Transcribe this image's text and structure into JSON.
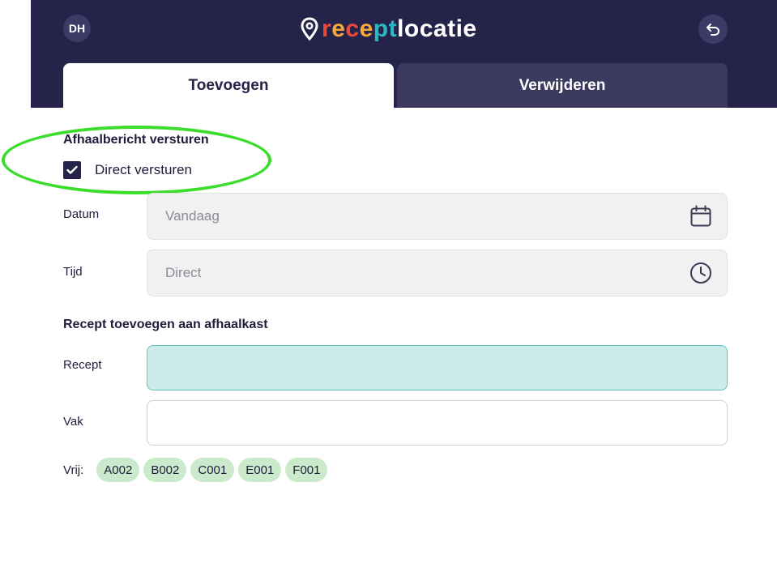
{
  "header": {
    "avatar_initials": "DH",
    "logo": {
      "part1": "r",
      "part2": "e",
      "part3": "c",
      "part4": "e",
      "part5": "pt",
      "part6": "locatie"
    },
    "back_icon": "undo-arrow-icon",
    "tabs": [
      {
        "label": "Toevoegen",
        "active": true
      },
      {
        "label": "Verwijderen",
        "active": false
      }
    ]
  },
  "afhaalbericht": {
    "title": "Afhaalbericht versturen",
    "checkbox_label": "Direct versturen",
    "checked": true
  },
  "datum": {
    "label": "Datum",
    "placeholder": "Vandaag",
    "icon": "calendar-icon"
  },
  "tijd": {
    "label": "Tijd",
    "placeholder": "Direct",
    "icon": "clock-icon"
  },
  "recept_section": {
    "title": "Recept toevoegen aan afhaalkast",
    "recept_label": "Recept",
    "recept_value": "",
    "vak_label": "Vak",
    "vak_value": ""
  },
  "vrij": {
    "label": "Vrij:",
    "chips": [
      "A002",
      "B002",
      "C001",
      "E001",
      "F001"
    ]
  },
  "colors": {
    "header_bg": "#25234a",
    "highlight": "#3bdd2a",
    "focused_field": "#cdebe9",
    "chip_bg": "#cbeacb"
  }
}
